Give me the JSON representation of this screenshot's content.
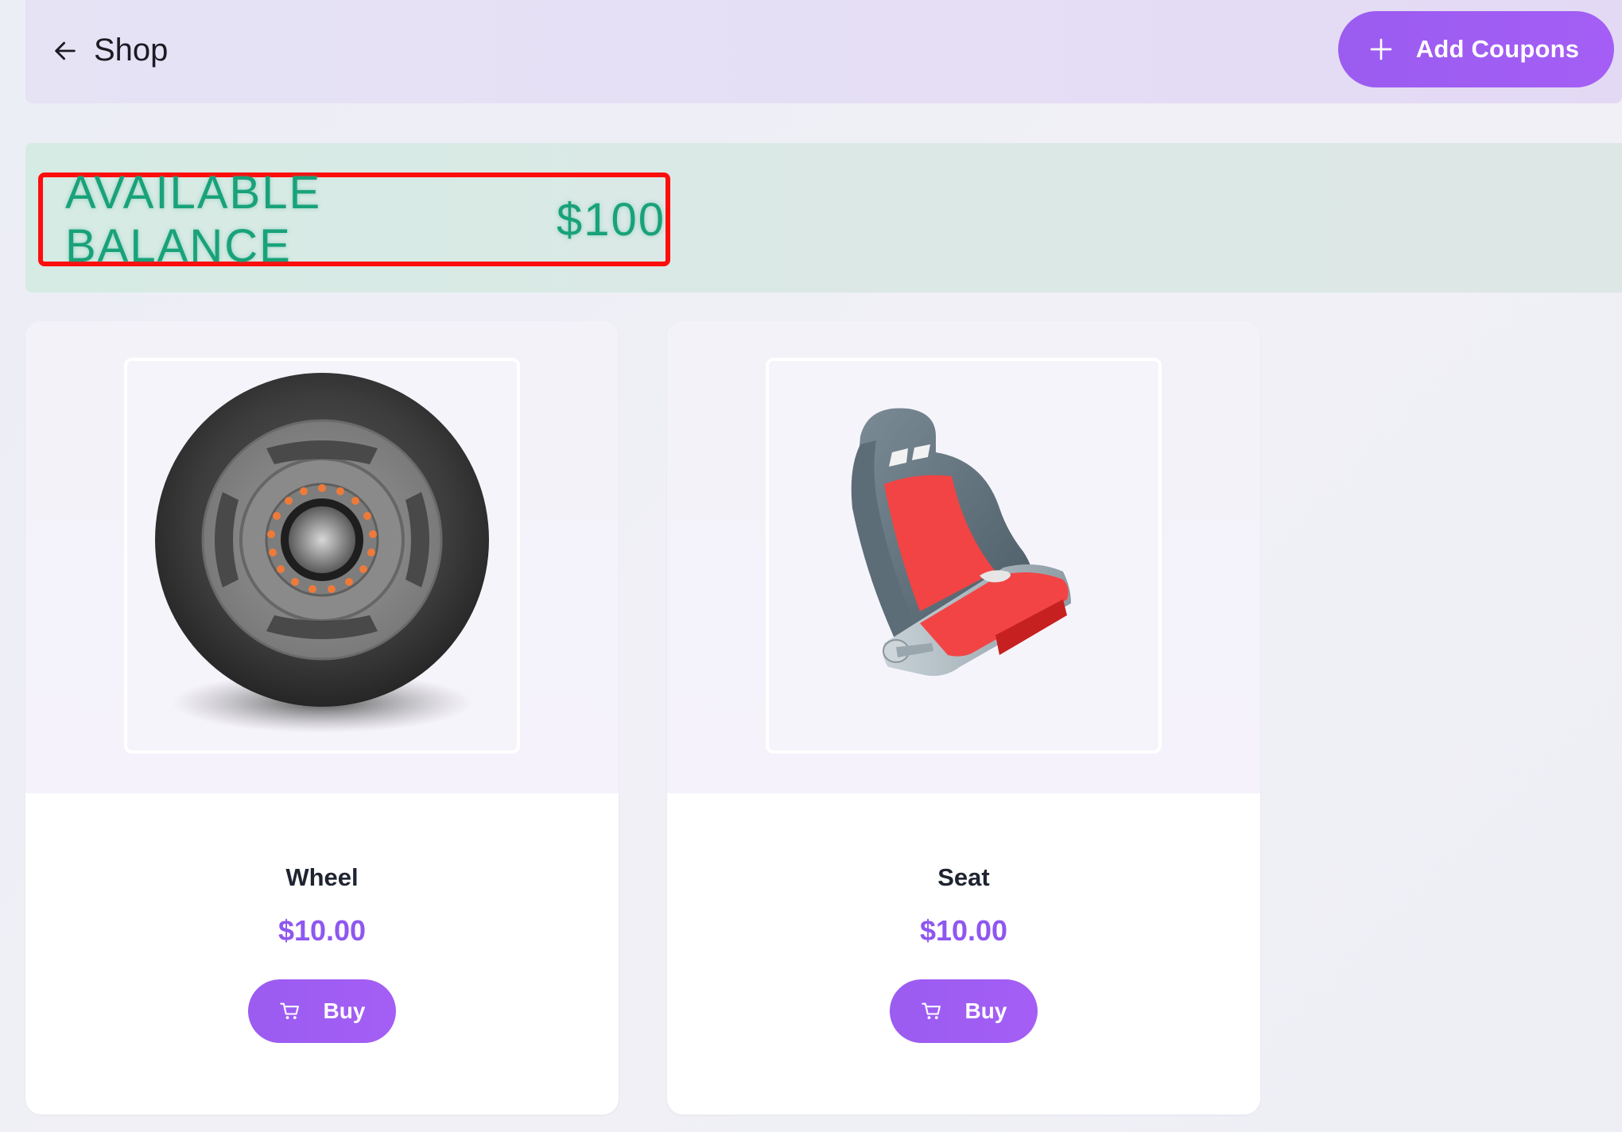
{
  "header": {
    "title": "Shop",
    "add_coupons_label": "Add Coupons"
  },
  "balance": {
    "label": "AVAILABLE BALANCE",
    "amount": "$100"
  },
  "products": [
    {
      "name": "Wheel",
      "price": "$10.00",
      "buy_label": "Buy",
      "image_icon": "wheel-image"
    },
    {
      "name": "Seat",
      "price": "$10.00",
      "buy_label": "Buy",
      "image_icon": "seat-image"
    }
  ],
  "colors": {
    "accent": "#9b5cf0",
    "balance_text": "#19a27a",
    "highlight_border": "#ff0d0d",
    "price": "#8f57ef"
  }
}
